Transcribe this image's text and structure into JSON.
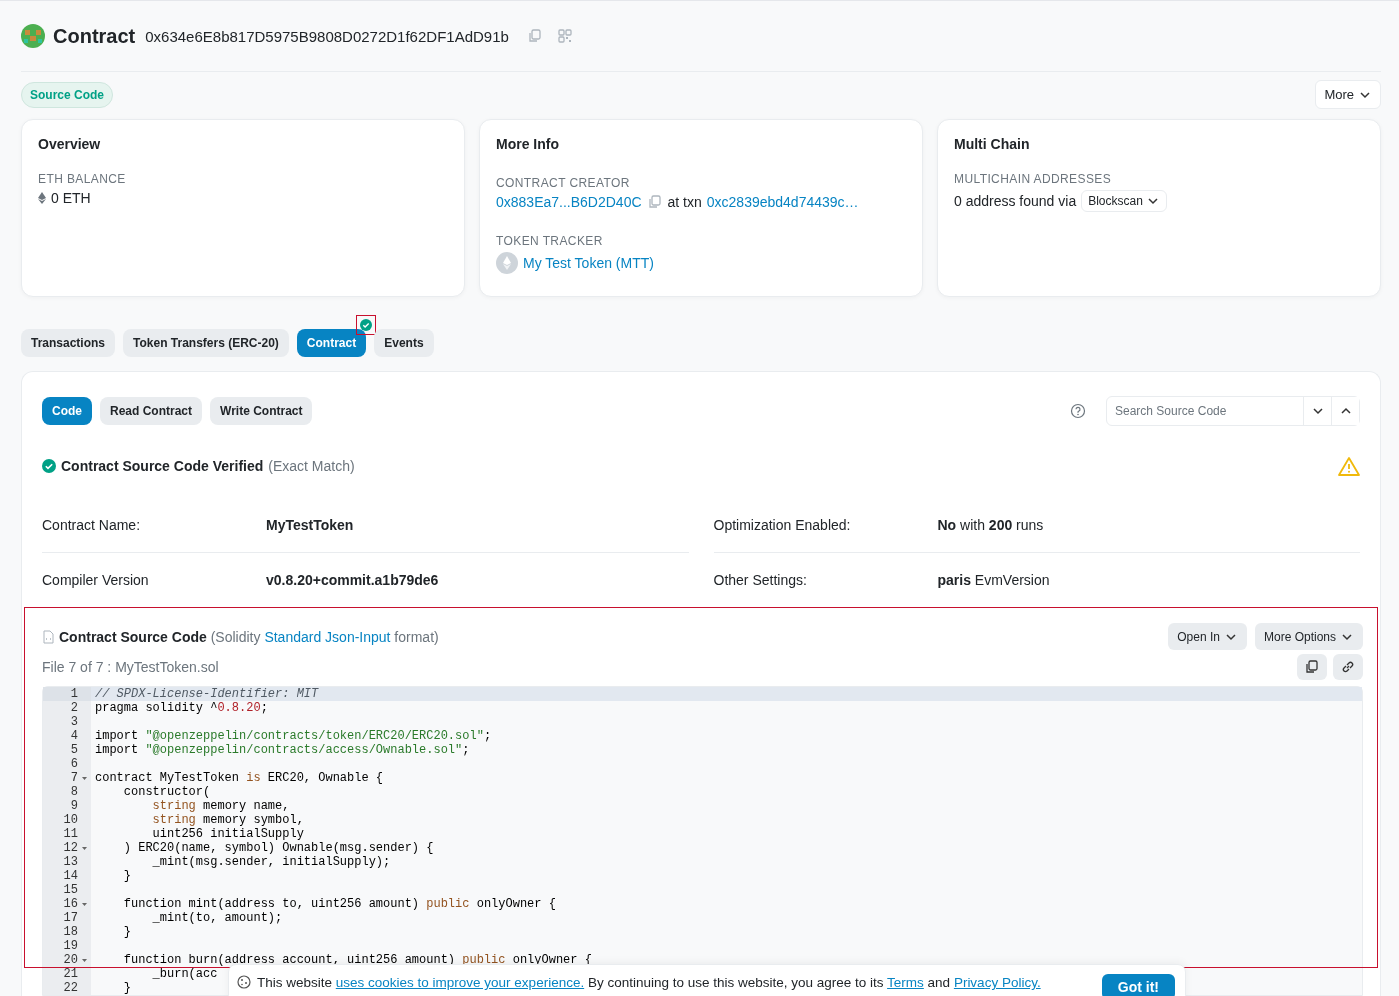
{
  "header": {
    "title": "Contract",
    "address": "0x634e6E8b817D5975B9808D0272D1f62DF1AdD91b"
  },
  "source_badge": "Source Code",
  "more_button": "More",
  "cards": [
    {
      "kind": "overview",
      "title": "Overview",
      "label": "ETH BALANCE",
      "value": "0 ETH"
    },
    {
      "kind": "info",
      "title": "More Info",
      "creator_label": "CONTRACT CREATOR",
      "creator": "0x883Ea7...B6D2D40C",
      "at_txn": "at txn",
      "txn": "0xc2839ebd4d74439c…",
      "tracker_label": "TOKEN TRACKER",
      "token": "My Test Token (MTT)"
    },
    {
      "kind": "multichain",
      "title": "Multi Chain",
      "label": "MULTICHAIN ADDRESSES",
      "value": "0 address found via",
      "dropdown": "Blockscan"
    }
  ],
  "tabs": [
    {
      "label": "Transactions",
      "selected": false,
      "verified": false
    },
    {
      "label": "Token Transfers (ERC-20)",
      "selected": false,
      "verified": false
    },
    {
      "label": "Contract",
      "selected": true,
      "verified": true,
      "highlighted": true
    },
    {
      "label": "Events",
      "selected": false,
      "verified": false
    }
  ],
  "subtabs": [
    {
      "label": "Code",
      "selected": true
    },
    {
      "label": "Read Contract",
      "selected": false
    },
    {
      "label": "Write Contract",
      "selected": false
    }
  ],
  "search": {
    "placeholder": "Search Source Code"
  },
  "verified": {
    "title": "Contract Source Code Verified",
    "note": "(Exact Match)"
  },
  "details": [
    {
      "label": "Contract Name:",
      "value": "MyTestToken",
      "emphasis": true
    },
    {
      "label": "Optimization Enabled:",
      "value": "**No** with **200** runs"
    },
    {
      "label": "Compiler Version",
      "value": "v0.8.20+commit.a1b79de6",
      "emphasis": true
    },
    {
      "label": "Other Settings:",
      "value": "**paris** EvmVersion"
    }
  ],
  "source": {
    "highlighted": true,
    "title": "Contract Source Code",
    "pre": "(Solidity",
    "link": "Standard Json-Input",
    "post": "format)",
    "file": "File 7 of 7 : MyTestToken.sol",
    "buttons": [
      "Open In",
      "More Options"
    ],
    "lines": [
      {
        "number": "1",
        "active": true,
        "foldable": false,
        "segments": [
          {
            "kind": "comment",
            "text": "// SPDX-License-Identifier: MIT"
          }
        ]
      },
      {
        "number": "2",
        "active": false,
        "foldable": false,
        "segments": [
          {
            "kind": "plain",
            "text": "pragma solidity ^"
          },
          {
            "kind": "number",
            "text": "0.8.20"
          },
          {
            "kind": "plain",
            "text": ";"
          }
        ]
      },
      {
        "number": "3",
        "active": false,
        "foldable": false
      },
      {
        "number": "4",
        "active": false,
        "foldable": false,
        "segments": [
          {
            "kind": "plain",
            "text": "import "
          },
          {
            "kind": "string",
            "text": "\"@openzeppelin/contracts/token/ERC20/ERC20.sol\""
          },
          {
            "kind": "plain",
            "text": ";"
          }
        ]
      },
      {
        "number": "5",
        "active": false,
        "foldable": false,
        "segments": [
          {
            "kind": "plain",
            "text": "import "
          },
          {
            "kind": "string",
            "text": "\"@openzeppelin/contracts/access/Ownable.sol\""
          },
          {
            "kind": "plain",
            "text": ";"
          }
        ]
      },
      {
        "number": "6",
        "active": false,
        "foldable": false
      },
      {
        "number": "7",
        "active": false,
        "foldable": true,
        "segments": [
          {
            "kind": "plain",
            "text": "contract MyTestToken "
          },
          {
            "kind": "keyword",
            "text": "is"
          },
          {
            "kind": "plain",
            "text": " ERC20, Ownable {"
          }
        ]
      },
      {
        "number": "8",
        "active": false,
        "foldable": false,
        "segments": [
          {
            "kind": "plain",
            "text": "    constructor("
          }
        ]
      },
      {
        "number": "9",
        "active": false,
        "foldable": false,
        "segments": [
          {
            "kind": "keyword",
            "text": "        string"
          },
          {
            "kind": "plain",
            "text": " memory name,"
          }
        ]
      },
      {
        "number": "10",
        "active": false,
        "foldable": false,
        "segments": [
          {
            "kind": "keyword",
            "text": "        string"
          },
          {
            "kind": "plain",
            "text": " memory symbol,"
          }
        ]
      },
      {
        "number": "11",
        "active": false,
        "foldable": false,
        "segments": [
          {
            "kind": "plain",
            "text": "        uint256 initialSupply"
          }
        ]
      },
      {
        "number": "12",
        "active": false,
        "foldable": true,
        "segments": [
          {
            "kind": "plain",
            "text": "    ) ERC20(name, symbol) Ownable(msg.sender) {"
          }
        ]
      },
      {
        "number": "13",
        "active": false,
        "foldable": false,
        "segments": [
          {
            "kind": "plain",
            "text": "        _mint(msg.sender, initialSupply);"
          }
        ]
      },
      {
        "number": "14",
        "active": false,
        "foldable": false,
        "segments": [
          {
            "kind": "plain",
            "text": "    }"
          }
        ]
      },
      {
        "number": "15",
        "active": false,
        "foldable": false
      },
      {
        "number": "16",
        "active": false,
        "foldable": true,
        "segments": [
          {
            "kind": "plain",
            "text": "    function mint(address to, uint256 amount) "
          },
          {
            "kind": "keyword",
            "text": "public"
          },
          {
            "kind": "plain",
            "text": " onlyOwner {"
          }
        ]
      },
      {
        "number": "17",
        "active": false,
        "foldable": false,
        "segments": [
          {
            "kind": "plain",
            "text": "        _mint(to, amount);"
          }
        ]
      },
      {
        "number": "18",
        "active": false,
        "foldable": false,
        "segments": [
          {
            "kind": "plain",
            "text": "    }"
          }
        ]
      },
      {
        "number": "19",
        "active": false,
        "foldable": false
      },
      {
        "number": "20",
        "active": false,
        "foldable": true,
        "segments": [
          {
            "kind": "plain",
            "text": "    function burn(address account, uint256 amount) "
          },
          {
            "kind": "keyword",
            "text": "public"
          },
          {
            "kind": "plain",
            "text": " onlyOwner {"
          }
        ]
      },
      {
        "number": "21",
        "active": false,
        "foldable": false,
        "segments": [
          {
            "kind": "plain",
            "text": "        _burn(acc"
          }
        ]
      },
      {
        "number": "22",
        "active": false,
        "foldable": false,
        "segments": [
          {
            "kind": "plain",
            "text": "    }"
          }
        ]
      }
    ]
  },
  "cookie": {
    "text": "This website",
    "link": "uses cookies to improve your experience.",
    "text2": "By continuing to use this website, you agree to its",
    "terms": "Terms",
    "and": "and",
    "privacy": "Privacy Policy.",
    "button": "Got it!"
  }
}
